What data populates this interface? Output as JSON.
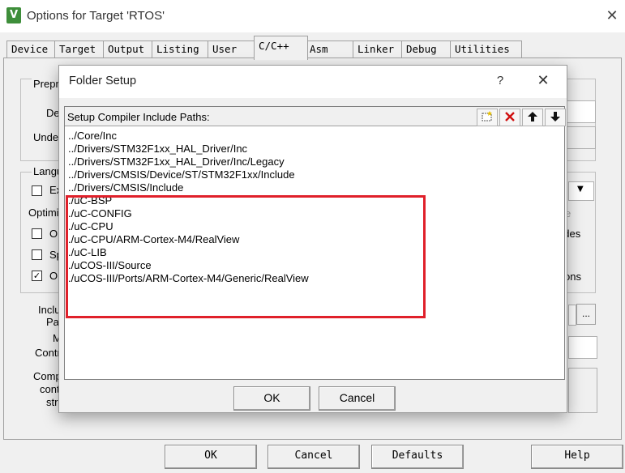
{
  "window": {
    "title": "Options for Target 'RTOS'",
    "app_icon_text": "V",
    "close_glyph": "✕"
  },
  "tabs": [
    "Device",
    "Target",
    "Output",
    "Listing",
    "User",
    "C/C++",
    "Asm",
    "Linker",
    "Debug",
    "Utilities"
  ],
  "active_tab": "C/C++",
  "background": {
    "preprocessor_label_partial": "Prepro",
    "define_label_partial": "Def",
    "undefine_label_partial": "Undef",
    "language_label_partial": "Langu",
    "exec_only_partial": "Ex",
    "optimization_partial": "Optimiz",
    "opt_check1_partial": "Op",
    "opt_check2_partial": "Sp",
    "opt_check3_partial": "On",
    "opt_check3_checked": true,
    "right_text_1": "e",
    "right_text_2": "udes",
    "right_text_3": "ons",
    "include_label_partial": "Inclu",
    "paths_label_partial": "Pat",
    "misc_label_partial": "M",
    "controls_label_partial": "Contr",
    "compiler_label_partial": "Comp",
    "control_label_partial": "cont",
    "string_label_partial": "stri",
    "browse_button": "..."
  },
  "bottom_buttons": {
    "ok": "OK",
    "cancel": "Cancel",
    "defaults": "Defaults",
    "help": "Help"
  },
  "folder_setup": {
    "title": "Folder Setup",
    "help_glyph": "?",
    "close_glyph": "✕",
    "list_label": "Setup Compiler Include Paths:",
    "paths": [
      "../Core/Inc",
      "../Drivers/STM32F1xx_HAL_Driver/Inc",
      "../Drivers/STM32F1xx_HAL_Driver/Inc/Legacy",
      "../Drivers/CMSIS/Device/ST/STM32F1xx/Include",
      "../Drivers/CMSIS/Include",
      "./uC-BSP",
      "./uC-CONFIG",
      "./uC-CPU",
      "./uC-CPU/ARM-Cortex-M4/RealView",
      "./uC-LIB",
      "./uCOS-III/Source",
      "./uCOS-III/Ports/ARM-Cortex-M4/Generic/RealView"
    ],
    "ok": "OK",
    "cancel": "Cancel",
    "highlight_color": "#e0202a"
  }
}
